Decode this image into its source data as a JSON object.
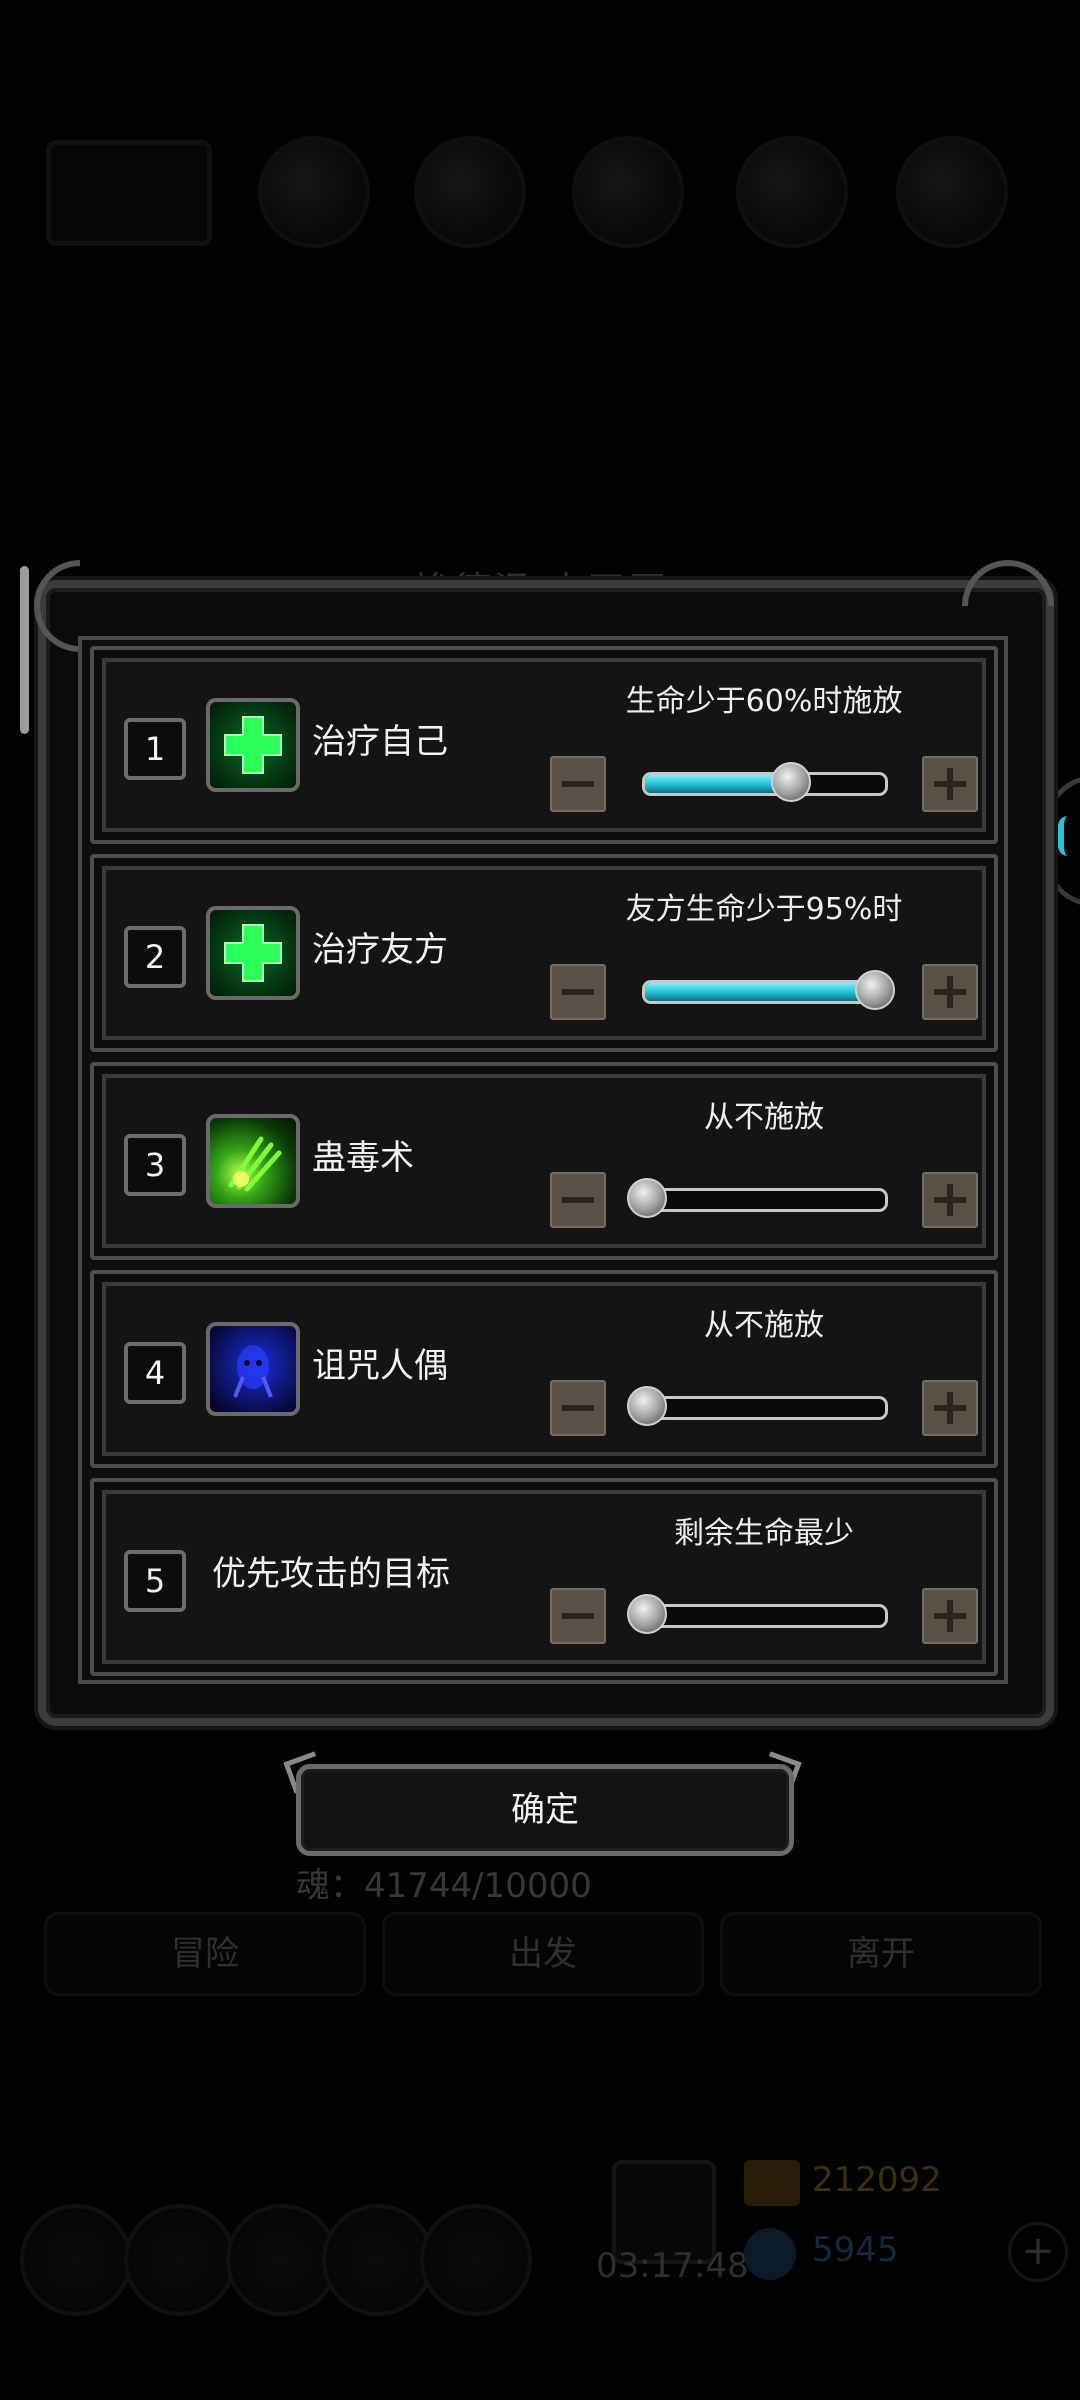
{
  "background": {
    "title": "埃德温 大平原",
    "soul_label": "魂：41744/10000",
    "tabs": [
      "冒险",
      "出发",
      "离开"
    ],
    "timer": "03:17:48",
    "gold": "212092",
    "gems": "5945"
  },
  "dialog": {
    "rows": [
      {
        "number": "1",
        "name": "治疗自己",
        "icon": "heal-cross-icon",
        "condition": "生命少于60%时施放",
        "slider_value": 0.6
      },
      {
        "number": "2",
        "name": "治疗友方",
        "icon": "heal-cross-icon",
        "condition": "友方生命少于95%时",
        "slider_value": 0.95
      },
      {
        "number": "3",
        "name": "蛊毒术",
        "icon": "poison-claw-icon",
        "condition": "从不施放",
        "slider_value": 0.0
      },
      {
        "number": "4",
        "name": "诅咒人偶",
        "icon": "curse-doll-icon",
        "condition": "从不施放",
        "slider_value": 0.0
      },
      {
        "number": "5",
        "name": "优先攻击的目标",
        "icon": null,
        "condition": "剩余生命最少",
        "slider_value": 0.0
      }
    ],
    "confirm_label": "确定"
  },
  "colors": {
    "slider_fill": "#1ab7c9",
    "heal_green": "#2cff5a",
    "step_button": "#5a5046"
  }
}
